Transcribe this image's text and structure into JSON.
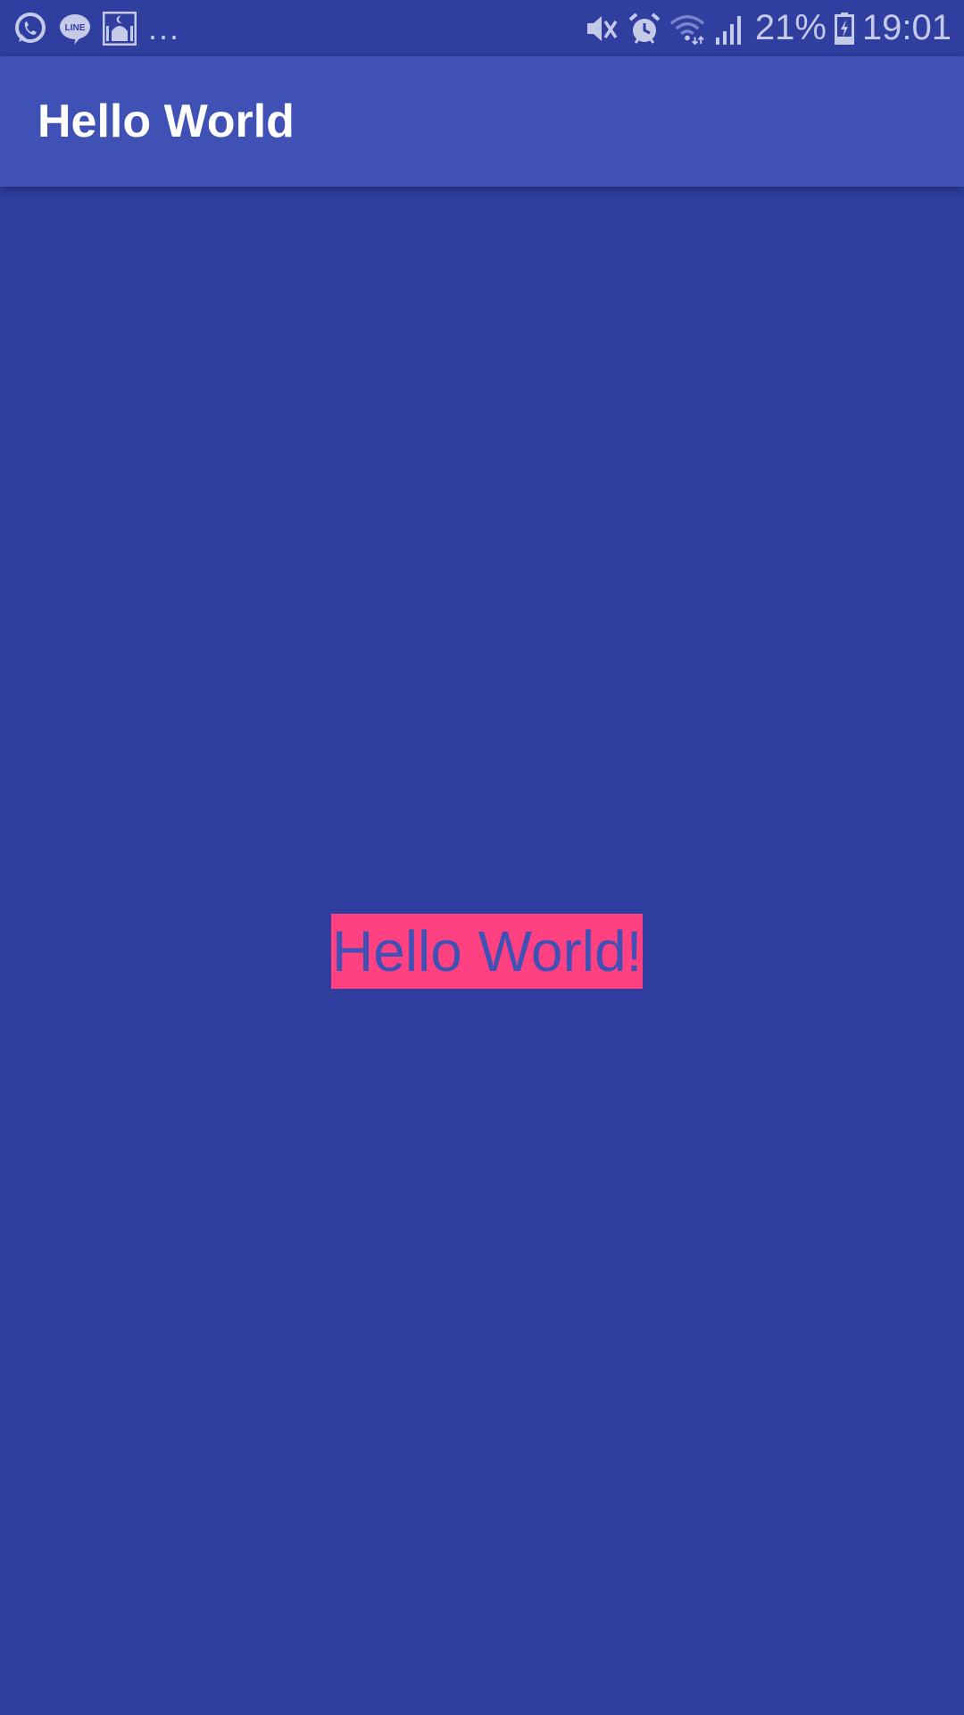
{
  "status_bar": {
    "notification_icons": [
      "whatsapp-icon",
      "line-icon",
      "mosque-icon"
    ],
    "more_indicator": "...",
    "system_icons": [
      "mute-icon",
      "alarm-icon",
      "wifi-icon",
      "signal-icon"
    ],
    "battery_percent": "21%",
    "time": "19:01"
  },
  "app_bar": {
    "title": "Hello World"
  },
  "main": {
    "label": "Hello World!"
  },
  "colors": {
    "background": "#2f3e9f",
    "app_bar": "#3f51b5",
    "accent": "#ff4081",
    "status_icons": "#c5cae9",
    "title_text": "#ffffff"
  }
}
